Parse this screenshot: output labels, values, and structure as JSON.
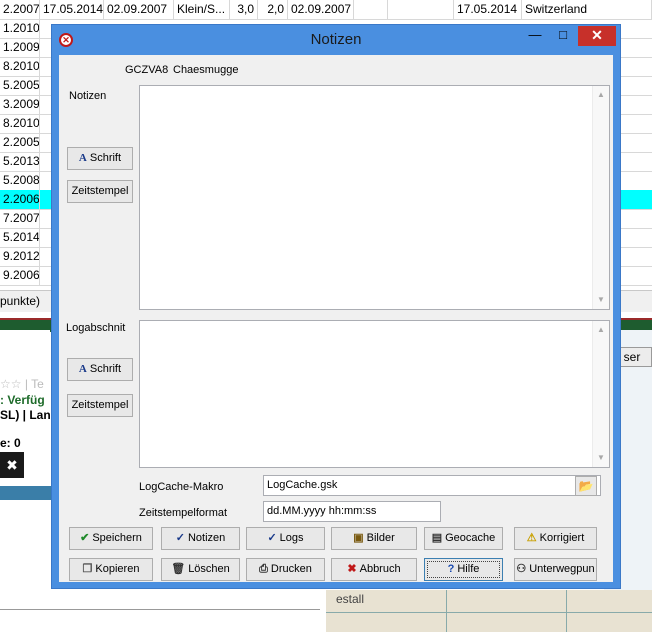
{
  "background": {
    "rows": [
      {
        "c0": "2.2007",
        "c1": "17.05.2014",
        "c2": "02.09.2007",
        "c3": "Klein/S...",
        "c4": "3,0",
        "c5": "2,0",
        "c6": "02.09.2007",
        "c7": "17.05.2014",
        "c8": "Switzerland"
      },
      {
        "c0": "1.2010"
      },
      {
        "c0": "1.2009"
      },
      {
        "c0": "8.2010"
      },
      {
        "c0": "5.2005"
      },
      {
        "c0": "3.2009"
      },
      {
        "c0": "8.2010"
      },
      {
        "c0": "2.2005"
      },
      {
        "c0": "5.2013"
      },
      {
        "c0": "5.2008"
      },
      {
        "c0": "2.2006",
        "selected": true
      },
      {
        "c0": "7.2007"
      },
      {
        "c0": "5.2014"
      },
      {
        "c0": "9.2012"
      },
      {
        "c0": "9.2006"
      }
    ],
    "status_text": "punkte)",
    "fragment_stars": "☆☆ | Te",
    "fragment_verf": ": Verfüg",
    "fragment_sl": "SL) | Lan",
    "fragment_e": "e: 0",
    "fragment_btn": "ser",
    "fragment_map": "estall"
  },
  "dialog": {
    "title": "Notizen",
    "cache_code": "GCZVA8",
    "cache_name": "Chaesmugge",
    "notes_label": "Notizen",
    "log_label": "Logabschnit",
    "font_button": "Schrift",
    "timestamp_button": "Zeitstempel",
    "macro_label": "LogCache-Makro",
    "macro_value": "LogCache.gsk",
    "timestamp_format_label": "Zeitstempelformat",
    "timestamp_format_value": "dd.MM.yyyy hh:mm:ss",
    "buttons_row1": {
      "save": "Speichern",
      "notes": "Notizen",
      "logs": "Logs",
      "images": "Bilder",
      "geocache": "Geocache",
      "corrected": "Korrigiert"
    },
    "buttons_row2": {
      "copy": "Kopieren",
      "delete": "Löschen",
      "print": "Drucken",
      "cancel": "Abbruch",
      "help": "Hilfe",
      "travel": "Unterwegpun"
    }
  },
  "colors": {
    "frame": "#4a8fe0",
    "selected_row": "#00ffff",
    "close": "#c7302a"
  }
}
